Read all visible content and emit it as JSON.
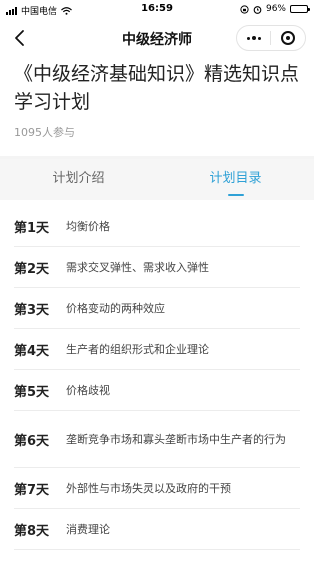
{
  "status_bar": {
    "carrier": "中国电信",
    "time": "16:59",
    "battery": "96%",
    "battery_level": 0.96
  },
  "nav": {
    "title": "中级经济师",
    "icons": [
      "chevron-left-icon",
      "more-icon",
      "close-circle-icon"
    ]
  },
  "plan": {
    "title": "《中级经济基础知识》精选知识点学习计划",
    "participants": "1095人参与"
  },
  "tabs": [
    {
      "label": "计划介绍",
      "active": false
    },
    {
      "label": "计划目录",
      "active": true
    }
  ],
  "schedule": [
    {
      "day": "第1天",
      "topic": "均衡价格"
    },
    {
      "day": "第2天",
      "topic": "需求交叉弹性、需求收入弹性"
    },
    {
      "day": "第3天",
      "topic": "价格变动的两种效应"
    },
    {
      "day": "第4天",
      "topic": "生产者的组织形式和企业理论"
    },
    {
      "day": "第5天",
      "topic": "价格歧视"
    },
    {
      "day": "第6天",
      "topic": "垄断竞争市场和寡头垄断市场中生产者的行为"
    },
    {
      "day": "第7天",
      "topic": "外部性与市场失灵以及政府的干预"
    },
    {
      "day": "第8天",
      "topic": "消费理论"
    }
  ],
  "colors": {
    "accent": "#2fa1d6",
    "tab_background": "#f6f6f6",
    "muted_text": "#999999"
  }
}
